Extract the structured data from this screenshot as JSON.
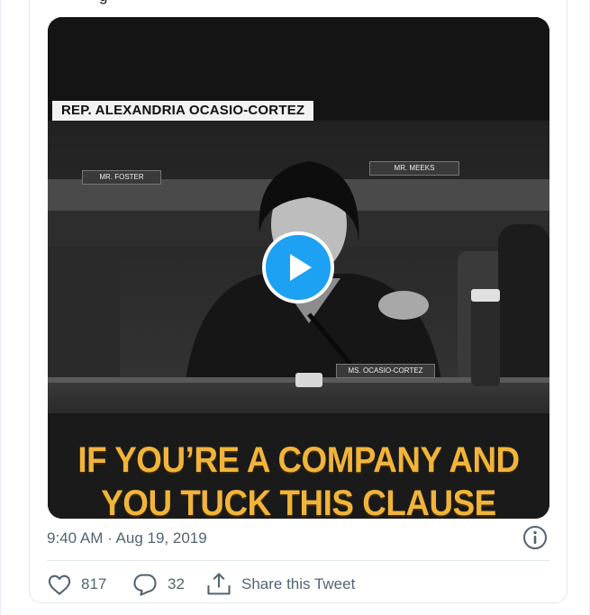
{
  "tweet": {
    "timestamp": "9:40 AM · Aug 19, 2019",
    "cut_text": "g"
  },
  "video": {
    "banner": "REP. ALEXANDRIA OCASIO-CORTEZ",
    "subtitle_line1": "IF YOU’RE A COMPANY AND",
    "subtitle_line2": "YOU TUCK THIS CLAUSE",
    "placards": {
      "foster": "MR. FOSTER",
      "meeks": "MR. MEEKS",
      "ocasio": "MS. OCASIO-CORTEZ"
    }
  },
  "actions": {
    "likes": "817",
    "replies": "32",
    "share_label": "Share this Tweet"
  },
  "colors": {
    "accent": "#1da1f2",
    "subtitle": "#f1b43a",
    "muted_text": "#536471"
  },
  "icons": [
    "play-icon",
    "info-icon",
    "heart-icon",
    "reply-icon",
    "share-icon"
  ]
}
